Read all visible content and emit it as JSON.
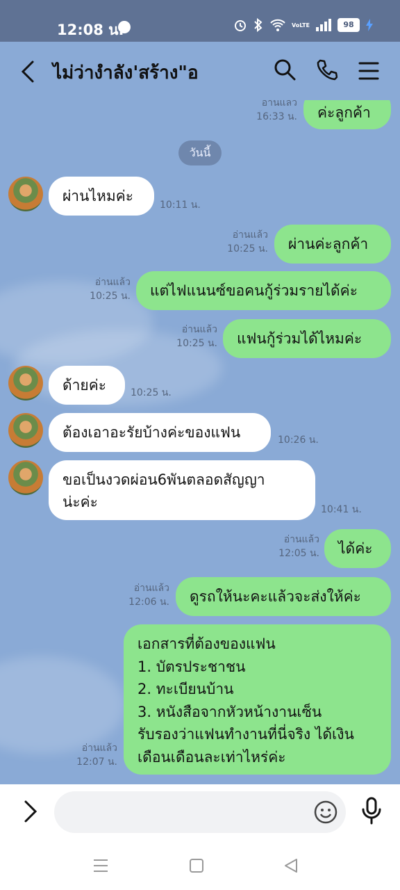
{
  "status_bar": {
    "time": "12:08 น.",
    "battery": "98",
    "signal_label": "VoLTE"
  },
  "header": {
    "title": "ไม่ว่างําลัง'สร้าง\"อ"
  },
  "chat": {
    "date_separator": "วันนี้",
    "messages": [
      {
        "id": "m0",
        "dir": "out",
        "text": "ค่ะลูกค้า",
        "read": "อ่านแล้ว",
        "time": "16:33 น."
      },
      {
        "id": "m1",
        "dir": "in",
        "text": "ผ่านไหมค่ะ",
        "time": "10:11 น."
      },
      {
        "id": "m2",
        "dir": "out",
        "text": "ผ่านค่ะลูกค้า",
        "read": "อ่านแล้ว",
        "time": "10:25 น."
      },
      {
        "id": "m3",
        "dir": "out",
        "text": "แต่ไฟแนนซ์ขอคนกู้ร่วมรายได้ค่ะ",
        "read": "อ่านแล้ว",
        "time": "10:25 น."
      },
      {
        "id": "m4",
        "dir": "out",
        "text": "แฟนกู้ร่วมได้ไหมค่ะ",
        "read": "อ่านแล้ว",
        "time": "10:25 น."
      },
      {
        "id": "m5",
        "dir": "in",
        "text": "ด้ายค่ะ",
        "time": "10:25 น."
      },
      {
        "id": "m6",
        "dir": "in",
        "text": "ต้องเอาอะรัยบ้างค่ะของแฟน",
        "time": "10:26 น."
      },
      {
        "id": "m7",
        "dir": "in",
        "lines": [
          "ขอเป็นงวดผ่อน6พันตลอดสัญญา",
          "น่ะค่ะ"
        ],
        "time": "10:41 น."
      },
      {
        "id": "m8",
        "dir": "out",
        "text": "ได้ค่ะ",
        "read": "อ่านแล้ว",
        "time": "12:05 น."
      },
      {
        "id": "m9",
        "dir": "out",
        "text": "ดูรถให้นะคะแล้วจะส่งให้ค่ะ",
        "read": "อ่านแล้ว",
        "time": "12:06 น."
      },
      {
        "id": "m10",
        "dir": "out",
        "lines": [
          "เอกสารที่ต้องของแฟน",
          "1. บัตรประชาชน",
          "2. ทะเบียนบ้าน",
          "3. หนังสือจากหัวหน้างานเซ็น",
          "รับรองว่าแฟนทำงานที่นี่จริง ได้เงิน",
          "เดือนเดือนละเท่าไหร่ค่ะ"
        ],
        "read": "อ่านแล้ว",
        "time": "12:07 น."
      }
    ]
  },
  "icons": {
    "back": "chevron-left-icon",
    "search": "search-icon",
    "call": "phone-icon",
    "menu": "hamburger-menu-icon",
    "expand": "chevron-right-icon",
    "emoji": "emoji-icon",
    "mic": "microphone-icon"
  },
  "colors": {
    "chat_background": "#8aaad6",
    "outgoing_bubble": "#8de48d",
    "incoming_bubble": "#ffffff",
    "status_bar": "#5f7294"
  }
}
